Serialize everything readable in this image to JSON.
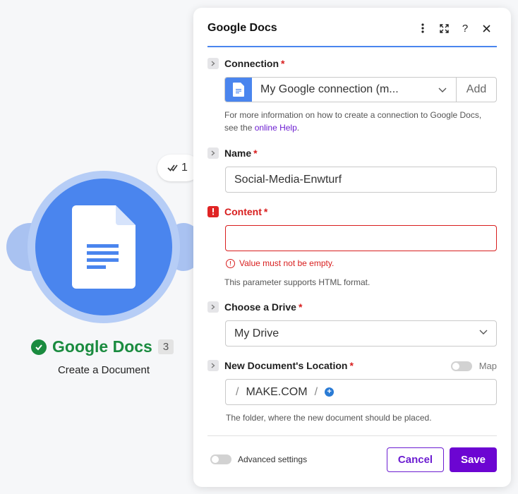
{
  "module": {
    "name": "Google Docs",
    "subtitle": "Create a Document",
    "operation_count": "3",
    "run_badge": "1",
    "status_color": "#1a8b3f",
    "brand_color": "#4a85ee"
  },
  "panel": {
    "title": "Google Docs",
    "header_icons": [
      "more-vertical-icon",
      "expand-icon",
      "help-icon",
      "close-icon"
    ],
    "help_glyph": "?",
    "connection": {
      "label": "Connection",
      "required_mark": "*",
      "value": "My Google connection (m...",
      "add_label": "Add",
      "help_text": "For more information on how to create a connection to Google Docs, see the",
      "help_link": "online Help",
      "help_end": "."
    },
    "name_field": {
      "label": "Name",
      "required_mark": "*",
      "value": "Social-Media-Enwturf"
    },
    "content_field": {
      "label": "Content",
      "required_mark": "*",
      "value": "",
      "error": "Value must not be empty.",
      "hint": "This parameter supports HTML format."
    },
    "drive_field": {
      "label": "Choose a Drive",
      "required_mark": "*",
      "value": "My Drive"
    },
    "location_field": {
      "label": "New Document's Location",
      "required_mark": "*",
      "map_label": "Map",
      "path_root": "MAKE.COM",
      "separator": "/",
      "hint": "The folder, where the new document should be placed."
    },
    "footer": {
      "advanced_label": "Advanced settings",
      "cancel_label": "Cancel",
      "save_label": "Save"
    },
    "accent_color": "#6c05d2",
    "error_color": "#d81e1e"
  }
}
